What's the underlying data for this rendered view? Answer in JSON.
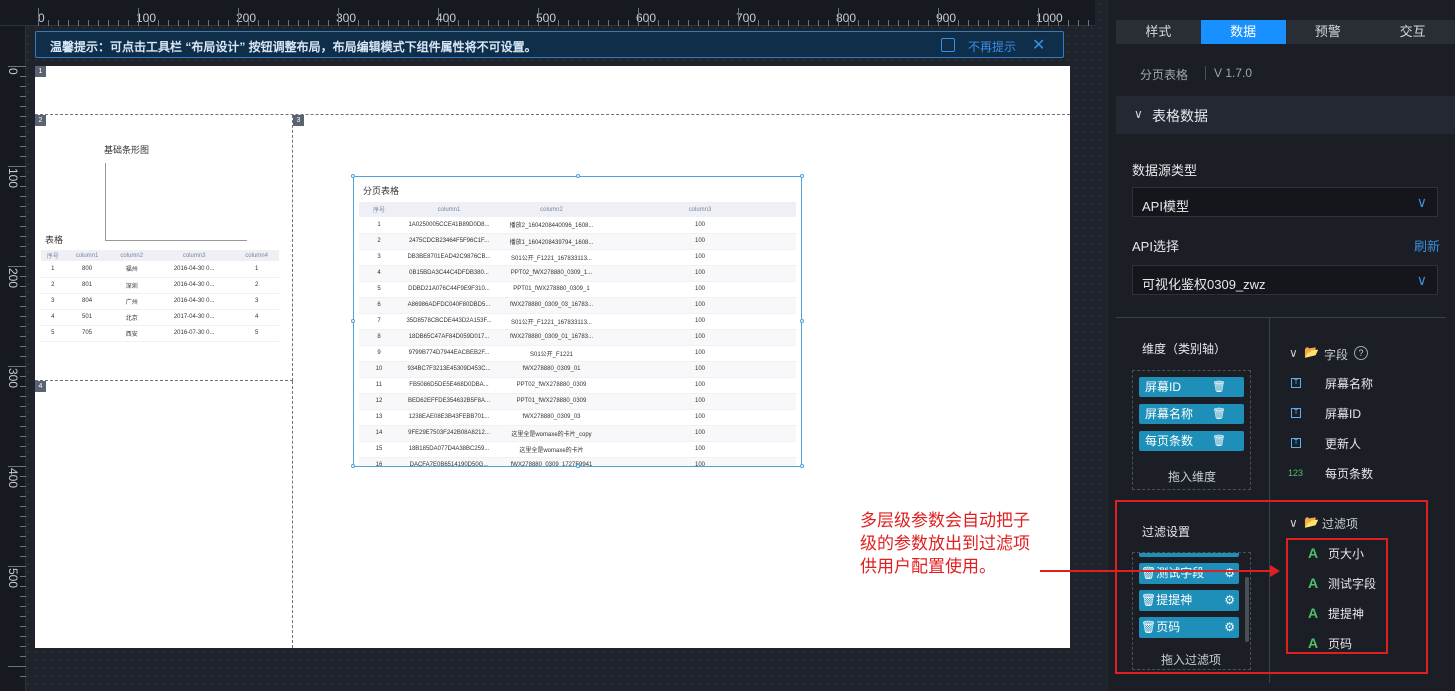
{
  "ruler": {
    "top_labels": [
      "0",
      "100",
      "200",
      "300",
      "400",
      "500",
      "600",
      "700",
      "800",
      "900",
      "1000"
    ],
    "left_labels": [
      "0",
      "100",
      "200",
      "300",
      "400",
      "500"
    ]
  },
  "notice": {
    "text": "温馨提示：可点击工具栏 “布局设计” 按钮调整布局，布局编辑模式下组件属性将不可设置。",
    "dismiss_label": "不再提示",
    "close_icon": "✕"
  },
  "canvas": {
    "blocks": [
      "1",
      "2",
      "3",
      "4"
    ],
    "bar_chart_title": "基础条形图",
    "mini_table": {
      "title": "表格",
      "headers": [
        "序号",
        "column1",
        "column2",
        "column3",
        "column4"
      ],
      "rows": [
        [
          "1",
          "800",
          "福州",
          "2016-04-30 0...",
          "1"
        ],
        [
          "2",
          "801",
          "深圳",
          "2016-04-30 0...",
          "2"
        ],
        [
          "3",
          "804",
          "广州",
          "2016-04-30 0...",
          "3"
        ],
        [
          "4",
          "501",
          "北京",
          "2017-04-30 0...",
          "4"
        ],
        [
          "5",
          "705",
          "西安",
          "2016-07-30 0...",
          "5"
        ]
      ]
    },
    "paged_table": {
      "title": "分页表格",
      "headers": [
        "序号",
        "column1",
        "column2",
        "column3"
      ],
      "rows": [
        [
          "1",
          "1A0250005CCE41B89D0D8...",
          "播放2_1604208440096_1608...",
          "100"
        ],
        [
          "2",
          "2475CDCB23464F5F96C1F...",
          "播放1_1604208439794_1608...",
          "100"
        ],
        [
          "3",
          "DB3BE8701EAD42C9876CB...",
          "S01公开_F1221_167833113...",
          "100"
        ],
        [
          "4",
          "0B15BDA3C44C4DFDB380...",
          "PPT02_fWX278880_0309_1...",
          "100"
        ],
        [
          "5",
          "DDBD21A076C44F9E9F310...",
          "PPT01_fWX278880_0309_1",
          "100"
        ],
        [
          "6",
          "A86986ADFDC040F80DBD5...",
          "fWX278880_0309_03_16783...",
          "100"
        ],
        [
          "7",
          "35D8578CBCDE443D2A153F...",
          "S01公开_F1221_167833113...",
          "100"
        ],
        [
          "8",
          "18DB65C47AF84D059D017...",
          "fWX278880_0309_01_16783...",
          "100"
        ],
        [
          "9",
          "9799B774D7944EACBEB2F...",
          "S01公开_F1221",
          "100"
        ],
        [
          "10",
          "934BC7F3213E45309D453C...",
          "fWX278880_0309_01",
          "100"
        ],
        [
          "11",
          "FB5086D5DE5E468D0DBA...",
          "PPT02_fWX278880_0309",
          "100"
        ],
        [
          "12",
          "BED62EFFDE354632B5F8A...",
          "PPT01_fWX278880_0309",
          "100"
        ],
        [
          "13",
          "1238EAE08E3B43FEBB701...",
          "fWX278880_0309_03",
          "100"
        ],
        [
          "14",
          "9FE29E7503F242B08A8212...",
          "这里全是womaxe的卡片_copy",
          "100"
        ],
        [
          "15",
          "18B185DA077D4A38BC259...",
          "这里全是womaxe的卡片",
          "100"
        ],
        [
          "16",
          "DACFA7E0B6514190D50G...",
          "fWX278880_0309_1727F9941",
          "100"
        ]
      ]
    }
  },
  "annotation": {
    "text": "多层级参数会自动把子级的参数放出到过滤项供用户配置使用。"
  },
  "panel": {
    "tabs": [
      "样式",
      "数据",
      "预警",
      "交互"
    ],
    "active_tab": "数据",
    "component_name": "分页表格",
    "version": "V 1.7.0",
    "section_title": "表格数据",
    "datasource_label": "数据源类型",
    "datasource_value": "API模型",
    "api_label": "API选择",
    "refresh_label": "刷新",
    "api_value": "可视化鉴权0309_zwz",
    "dimension_label": "维度（类别轴）",
    "dimension_chips": [
      "屏幕ID",
      "屏幕名称",
      "每页条数"
    ],
    "dimension_drop": "拖入维度",
    "filter_label": "过滤设置",
    "filter_chips": [
      "测试字段",
      "提提神",
      "页码"
    ],
    "filter_drop": "拖入过滤项",
    "fields_header": "字段",
    "fields": [
      {
        "icon": "T",
        "name": "屏幕名称"
      },
      {
        "icon": "T",
        "name": "屏幕ID"
      },
      {
        "icon": "T",
        "name": "更新人"
      },
      {
        "icon": "123",
        "name": "每页条数"
      }
    ],
    "filter_header": "过滤项",
    "filter_items": [
      "页大小",
      "测试字段",
      "提提神",
      "页码"
    ]
  }
}
